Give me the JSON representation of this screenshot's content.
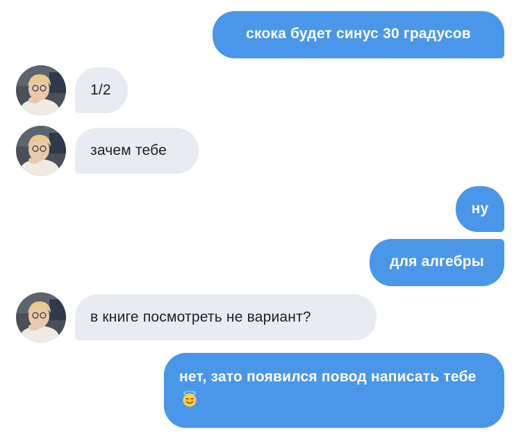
{
  "conversation": {
    "messages": [
      {
        "direction": "outgoing",
        "text": "скока будет синус 30 градусов"
      },
      {
        "direction": "incoming",
        "text": "1/2"
      },
      {
        "direction": "incoming",
        "text": "зачем тебе"
      },
      {
        "direction": "outgoing",
        "text": "ну"
      },
      {
        "direction": "outgoing",
        "text": "для алгебры"
      },
      {
        "direction": "incoming",
        "text": "в книге посмотреть не вариант?"
      },
      {
        "direction": "outgoing",
        "text": "нет, зато появился повод написать тебе",
        "emoji": "smiling-face-with-halo"
      }
    ]
  },
  "colors": {
    "outgoing_bubble": "#4a97ea",
    "incoming_bubble": "#e9ebf2",
    "outgoing_text": "#ffffff",
    "incoming_text": "#1f1f24"
  }
}
